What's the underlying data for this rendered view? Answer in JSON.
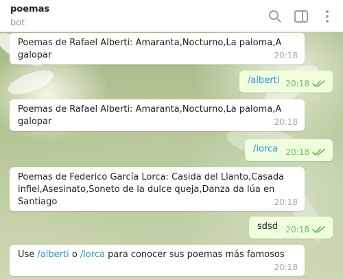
{
  "header": {
    "title": "poemas",
    "subtitle": "bot",
    "icons": [
      "search-icon",
      "sidebar-icon",
      "more-icon"
    ]
  },
  "colors": {
    "incoming_bubble": "#ffffff",
    "outgoing_bubble": "#efffde",
    "command_link": "#2a96d6",
    "outgoing_time": "#6cbf5a"
  },
  "messages": [
    {
      "text": "Poemas de Rafael Alberti: Amaranta,Nocturno,La paloma,A galopar",
      "time": "20:18"
    },
    {
      "text": "/alberti",
      "time": "20:18"
    },
    {
      "text": "Poemas de Rafael Alberti: Amaranta,Nocturno,La paloma,A galopar",
      "time": "20:18"
    },
    {
      "text": "/lorca",
      "time": "20:18"
    },
    {
      "text": "Poemas de Federico García Lorca: Casida del Llanto,Casada infiel,Asesinato,Soneto de la dulce queja,Danza da lúa en Santiago",
      "time": "20:18"
    },
    {
      "text": "sdsd",
      "time": "20:18"
    },
    {
      "prefix": "Use ",
      "cmd1": "/alberti",
      "mid": " o ",
      "cmd2": "/lorca",
      "suffix": " para conocer sus poemas más famosos",
      "time": "20:18"
    }
  ]
}
